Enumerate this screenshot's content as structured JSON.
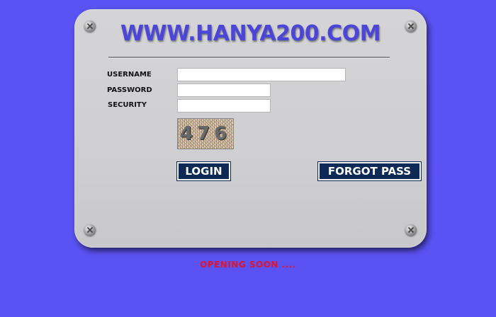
{
  "site_title": "WWW.HANYA200.COM",
  "form": {
    "username_label": "USERNAME",
    "password_label": "PASSWORD",
    "security_label": "SECURITY",
    "username_value": "",
    "password_value": "",
    "security_value": "",
    "captcha_text": "476"
  },
  "buttons": {
    "login_label": "LOGIN",
    "forgot_label": "FORGOT PASS"
  },
  "footer": {
    "status_text": "OPENING SOON ...."
  },
  "colors": {
    "background": "#5a52f2",
    "panel": "#d0d0d3",
    "title": "#4c46d8",
    "button": "#0d2a57",
    "status": "#e0142c"
  }
}
